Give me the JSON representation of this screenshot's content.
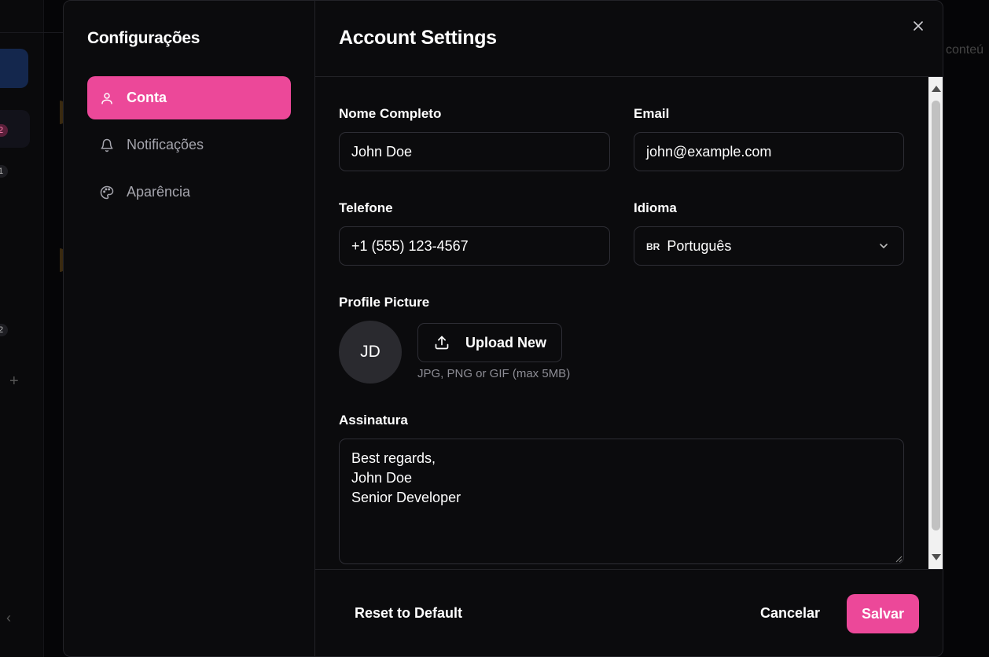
{
  "background": {
    "badges": [
      "2",
      "1",
      "2"
    ],
    "partial_text": "conteú"
  },
  "sidebar": {
    "title": "Configurações",
    "items": [
      {
        "label": "Conta",
        "icon": "user-icon",
        "active": true
      },
      {
        "label": "Notificações",
        "icon": "bell-icon",
        "active": false
      },
      {
        "label": "Aparência",
        "icon": "palette-icon",
        "active": false
      }
    ]
  },
  "main": {
    "title": "Account Settings",
    "fields": {
      "name": {
        "label": "Nome Completo",
        "value": "John Doe"
      },
      "email": {
        "label": "Email",
        "value": "john@example.com"
      },
      "phone": {
        "label": "Telefone",
        "value": "+1 (555) 123-4567"
      },
      "language": {
        "label": "Idioma",
        "flag": "BR",
        "value": "Português"
      }
    },
    "profile": {
      "label": "Profile Picture",
      "initials": "JD",
      "upload_label": "Upload New",
      "hint": "JPG, PNG or GIF (max 5MB)"
    },
    "signature": {
      "label": "Assinatura",
      "value": "Best regards,\nJohn Doe\nSenior Developer"
    }
  },
  "footer": {
    "reset_label": "Reset to Default",
    "cancel_label": "Cancelar",
    "save_label": "Salvar"
  },
  "colors": {
    "accent": "#ec4899",
    "background": "#0b0b0d",
    "border": "#2e2e35"
  }
}
